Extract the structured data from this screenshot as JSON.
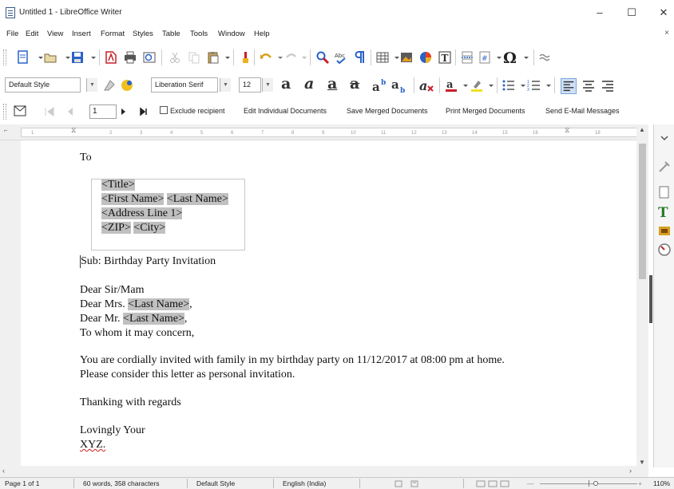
{
  "window": {
    "title": "Untitled 1 - LibreOffice Writer"
  },
  "menu": [
    "File",
    "Edit",
    "View",
    "Insert",
    "Format",
    "Styles",
    "Table",
    "Tools",
    "Window",
    "Help"
  ],
  "format_bar": {
    "paragraph_style": "Default Style",
    "font_name": "Liberation Serif",
    "font_size": "12"
  },
  "mail_merge_bar": {
    "record_number": "1",
    "exclude_recipient": "Exclude recipient",
    "edit_individual": "Edit Individual Documents",
    "save_merged": "Save Merged Documents",
    "print_merged": "Print Merged Documents",
    "send_email": "Send E-Mail Messages"
  },
  "ruler": {
    "numbers": [
      "1",
      "2",
      "3",
      "4",
      "5",
      "6",
      "7",
      "8",
      "9",
      "10",
      "11",
      "12",
      "13",
      "14",
      "15",
      "16",
      "18"
    ]
  },
  "document": {
    "to": "To",
    "address": {
      "title": "<Title>",
      "first_name": "<First Name>",
      "last_name": "<Last Name>",
      "address_line_1": "<Address Line 1>",
      "zip": "<ZIP>",
      "city": "<City>"
    },
    "subject": "Sub: Birthday Party Invitation",
    "salutation_1": "Dear Sir/Mam",
    "salutation_2_prefix": "Dear Mrs. ",
    "salutation_2_field": "<Last Name>",
    "salutation_3_prefix": "Dear Mr. ",
    "salutation_3_field": "<Last Name>",
    "comma": ",",
    "salutation_4": "To whom it may concern,",
    "body_1": "You are cordially invited with family in my birthday party on 11/12/2017 at 08:00 pm at home.",
    "body_2": "Please consider this letter as personal invitation.",
    "closing_1": "Thanking with regards",
    "closing_2": "Lovingly Your",
    "signature": "XYZ."
  },
  "status": {
    "page": "Page 1 of 1",
    "words": "60 words, 358 characters",
    "style": "Default Style",
    "language": "English (India)",
    "zoom": "110%"
  },
  "colors": {
    "field_shading": "#c0c0c0",
    "spell_error": "#d02020",
    "accent_blue": "#2a62c8"
  }
}
